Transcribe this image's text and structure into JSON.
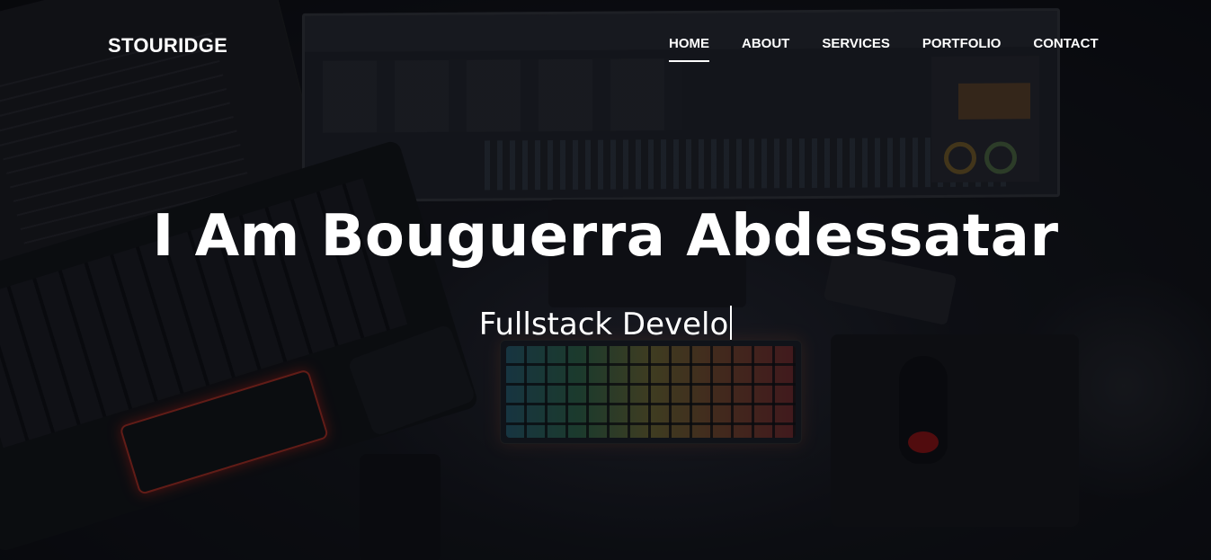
{
  "site": {
    "logo": "STOURIDGE"
  },
  "nav": {
    "items": [
      {
        "label": "HOME",
        "active": true
      },
      {
        "label": "ABOUT",
        "active": false
      },
      {
        "label": "SERVICES",
        "active": false
      },
      {
        "label": "PORTFOLIO",
        "active": false
      },
      {
        "label": "CONTACT",
        "active": false
      }
    ]
  },
  "hero": {
    "title": "I Am Bouguerra Abdessatar",
    "typed_text": "Fullstack Develo"
  },
  "colors": {
    "text": "#ffffff",
    "overlay": "#08090d"
  }
}
